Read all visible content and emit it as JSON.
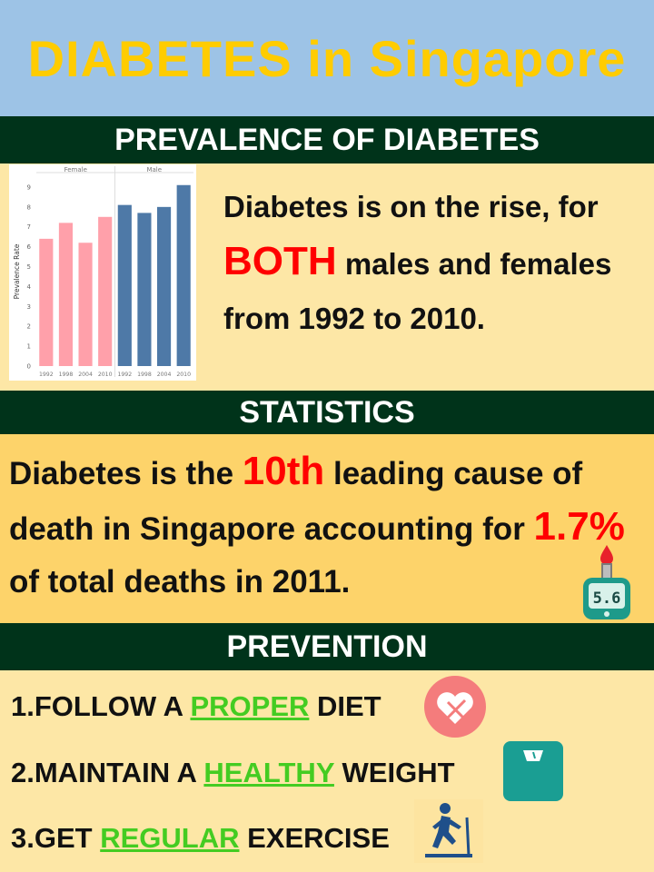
{
  "title": "DIABETES in Singapore",
  "sections": {
    "prevalence": {
      "heading": "PREVALENCE OF DIABETES"
    },
    "statistics": {
      "heading": "STATISTICS"
    },
    "prevention": {
      "heading": "PREVENTION"
    }
  },
  "prevalence_text": {
    "part1": "Diabetes is on the rise, for ",
    "highlight": "BOTH",
    "part2": " males and females from 1992 to 2010."
  },
  "statistics_text": {
    "part1": "Diabetes is the ",
    "highlight1": "10th",
    "part2": " leading cause of death in Singapore accounting for ",
    "highlight2": "1.7%",
    "part3": " of total deaths in 2011."
  },
  "prevention_items": [
    {
      "prefix": "1.FOLLOW A ",
      "highlight": "PROPER",
      "suffix": " DIET"
    },
    {
      "prefix": "2.MAINTAIN A ",
      "highlight": "HEALTHY",
      "suffix": " WEIGHT"
    },
    {
      "prefix": "3.GET ",
      "highlight": "REGULAR",
      "suffix": " EXERCISE"
    }
  ],
  "icons": {
    "glucose_meter": {
      "name": "glucose-meter-icon",
      "reading": "5.6"
    },
    "diet": "heart-plate-icon",
    "weight": "scale-icon",
    "exercise": "treadmill-runner-icon"
  },
  "colors": {
    "title_bg": "#9dc3e6",
    "title_text": "#ffcc00",
    "section_bg": "#00331a",
    "panel_yellow": "#fde7a6",
    "panel_orange": "#fdd36a",
    "highlight_red": "#ff0000",
    "highlight_green": "#44cc22",
    "female_bar": "#ffa0aa",
    "male_bar": "#4e79a7"
  },
  "chart_data": {
    "type": "bar",
    "ylabel": "Prevalence Rate",
    "ylim": [
      0,
      9.5
    ],
    "yticks": [
      0,
      1,
      2,
      3,
      4,
      5,
      6,
      7,
      8,
      9
    ],
    "panels": [
      "Female",
      "Male"
    ],
    "categories": [
      "1992",
      "1998",
      "2004",
      "2010",
      "1992",
      "1998",
      "2004",
      "2010"
    ],
    "series": [
      {
        "name": "Female",
        "x": [
          "1992",
          "1998",
          "2004",
          "2010"
        ],
        "values": [
          6.4,
          7.2,
          6.2,
          7.5
        ]
      },
      {
        "name": "Male",
        "x": [
          "1992",
          "1998",
          "2004",
          "2010"
        ],
        "values": [
          8.1,
          7.7,
          8.0,
          9.1
        ]
      }
    ],
    "grid": false,
    "legend": "none"
  }
}
